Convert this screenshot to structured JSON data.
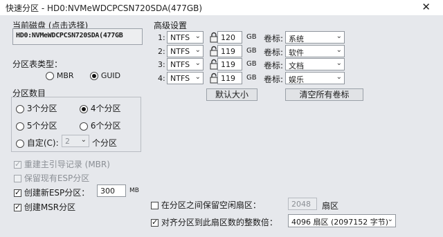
{
  "window": {
    "title": "快速分区 - HD0:NVMeWDCPCSN720SDA(477GB)",
    "close_glyph": "✕"
  },
  "disk": {
    "label": "当前磁盘 (点击选择)",
    "value": "HD0:NVMeWDCPCSN720SDA(477GB"
  },
  "partition_table": {
    "label": "分区表类型：",
    "options": [
      "MBR",
      "GUID"
    ],
    "selected": "GUID"
  },
  "partition_count": {
    "label": "分区数目",
    "options": [
      "3个分区",
      "4个分区",
      "5个分区",
      "6个分区"
    ],
    "selected": "4个分区",
    "custom_label": "自定(C):",
    "custom_value": "2",
    "custom_suffix": "个分区"
  },
  "options": {
    "rebuild_mbr": {
      "label": "重建主引导记录 (MBR)",
      "checked": true,
      "disabled": true
    },
    "keep_esp": {
      "label": "保留现有ESP分区",
      "checked": false,
      "disabled": true
    },
    "create_esp": {
      "label": "创建新ESP分区：",
      "checked": true,
      "value": "300",
      "unit": "MB"
    },
    "create_msr": {
      "label": "创建MSR分区",
      "checked": true
    }
  },
  "advanced": {
    "label": "高级设置",
    "size_unit": "GB",
    "volume_label_text": "卷标:",
    "rows": [
      {
        "index": "1:",
        "fs": "NTFS",
        "size": "120",
        "volume": "系统"
      },
      {
        "index": "2:",
        "fs": "NTFS",
        "size": "119",
        "volume": "软件"
      },
      {
        "index": "3:",
        "fs": "NTFS",
        "size": "119",
        "volume": "文档"
      },
      {
        "index": "4:",
        "fs": "NTFS",
        "size": "119",
        "volume": "娱乐"
      }
    ],
    "default_size_button": "默认大小",
    "clear_labels_button": "清空所有卷标"
  },
  "sectors": {
    "reserve_label": "在分区之间保留空闲扇区：",
    "reserve_checked": false,
    "reserve_value": "2048",
    "reserve_unit": "扇区",
    "align_label": "对齐分区到此扇区数的整数倍：",
    "align_checked": true,
    "align_value": "4096 扇区 (2097152 字节)"
  }
}
